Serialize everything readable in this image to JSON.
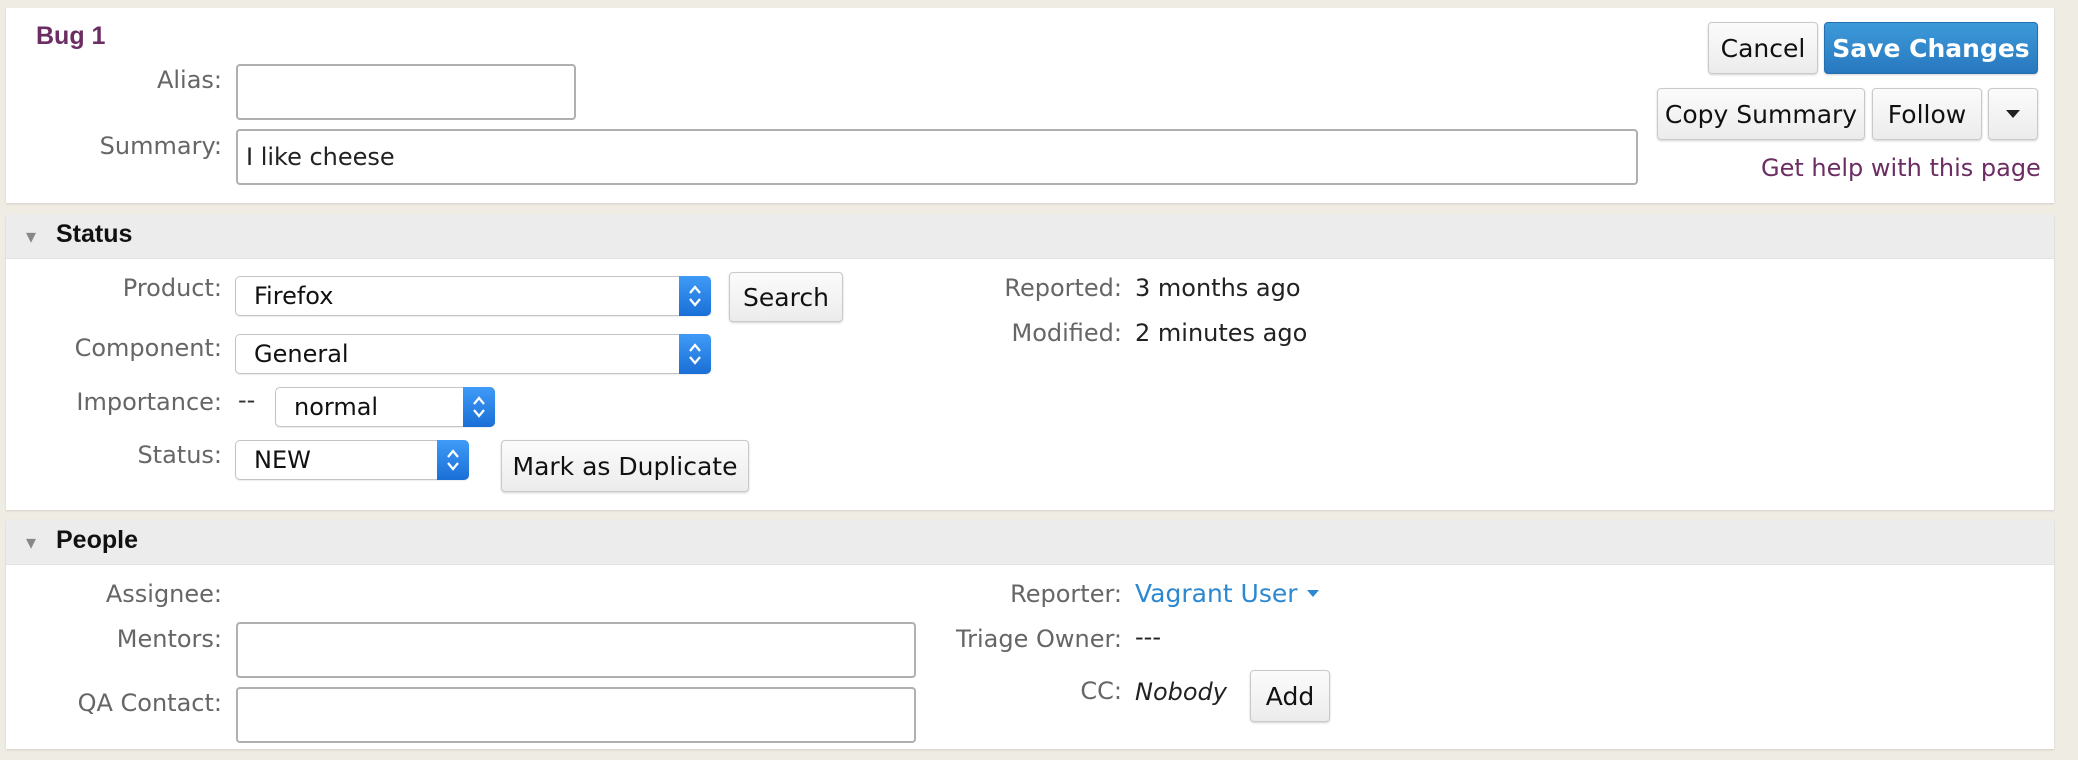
{
  "header": {
    "bug_title": "Bug 1",
    "alias_label": "Alias:",
    "alias_value": "",
    "summary_label": "Summary:",
    "summary_value": "I like cheese",
    "cancel_label": "Cancel",
    "save_label": "Save Changes",
    "copy_summary_label": "Copy Summary",
    "follow_label": "Follow",
    "help_link": "Get help with this page"
  },
  "status": {
    "section_title": "Status",
    "product_label": "Product:",
    "product_value": "Firefox",
    "search_label": "Search",
    "component_label": "Component:",
    "component_value": "General",
    "importance_label": "Importance:",
    "importance_prefix": "--",
    "importance_value": "normal",
    "status_label": "Status:",
    "status_value": "NEW",
    "mark_duplicate_label": "Mark as Duplicate",
    "reported_label": "Reported:",
    "reported_value": "3 months ago",
    "modified_label": "Modified:",
    "modified_value": "2 minutes ago"
  },
  "people": {
    "section_title": "People",
    "assignee_label": "Assignee:",
    "mentors_label": "Mentors:",
    "mentors_value": "",
    "qa_contact_label": "QA Contact:",
    "qa_contact_value": "",
    "reporter_label": "Reporter:",
    "reporter_value": "Vagrant User",
    "triage_owner_label": "Triage Owner:",
    "triage_owner_value": "---",
    "cc_label": "CC:",
    "cc_value": "Nobody",
    "add_label": "Add"
  },
  "colors": {
    "accent_blue": "#2878bf",
    "link_purple": "#6b2d62",
    "link_blue": "#2c88d0",
    "select_arrow_blue": "#1a6fd6"
  },
  "icons": {
    "section_toggle": "triangle-down-icon",
    "select_arrows": "updown-chevron-icon",
    "menu": "caret-down-icon"
  }
}
